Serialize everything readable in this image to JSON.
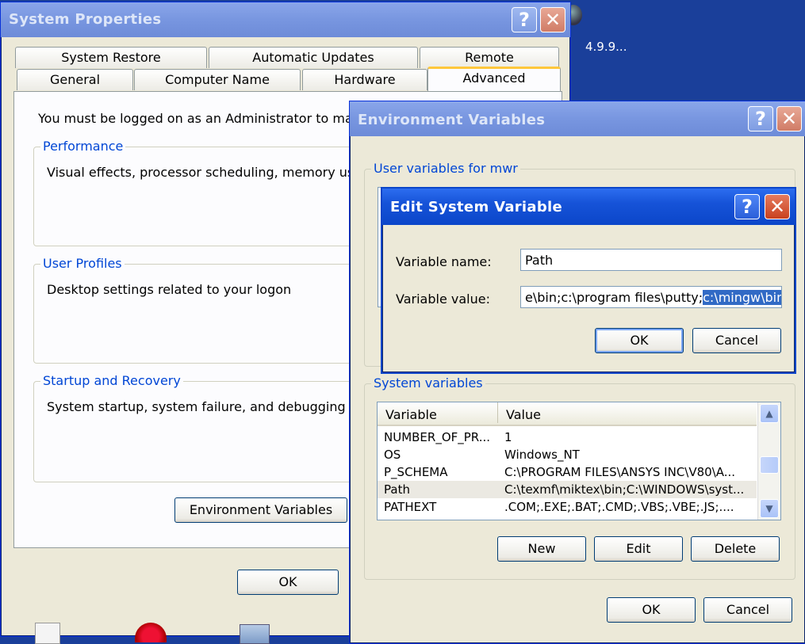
{
  "desktop": {
    "text": "4.9.9..."
  },
  "system_properties": {
    "title": "System Properties",
    "tabs_row1": [
      "System Restore",
      "Automatic Updates",
      "Remote"
    ],
    "tabs_row2": [
      "General",
      "Computer Name",
      "Hardware",
      "Advanced"
    ],
    "active_tab": "Advanced",
    "admin_notice": "You must be logged on as an Administrator to make",
    "performance": {
      "label": "Performance",
      "text": "Visual effects, processor scheduling, memory usa"
    },
    "user_profiles": {
      "label": "User Profiles",
      "text": "Desktop settings related to your logon"
    },
    "startup_recovery": {
      "label": "Startup and Recovery",
      "text": "System startup, system failure, and debugging info"
    },
    "env_button": "Environment Variables",
    "ok": "OK"
  },
  "environment_variables": {
    "title": "Environment Variables",
    "user_group_label": "User variables for mwr",
    "system_group_label": "System variables",
    "columns": [
      "Variable",
      "Value"
    ],
    "rows": [
      {
        "variable": "NUMBER_OF_PR...",
        "value": "1"
      },
      {
        "variable": "OS",
        "value": "Windows_NT"
      },
      {
        "variable": "P_SCHEMA",
        "value": "C:\\PROGRAM FILES\\ANSYS INC\\V80\\A..."
      },
      {
        "variable": "Path",
        "value": "C:\\texmf\\miktex\\bin;C:\\WINDOWS\\syst..."
      },
      {
        "variable": "PATHEXT",
        "value": ".COM;.EXE;.BAT;.CMD;.VBS;.VBE;.JS;...."
      }
    ],
    "selected_row_index": 3,
    "new": "New",
    "edit": "Edit",
    "delete": "Delete",
    "ok": "OK",
    "cancel": "Cancel"
  },
  "edit_system_variable": {
    "title": "Edit System Variable",
    "name_label": "Variable name:",
    "name_value": "Path",
    "value_label": "Variable value:",
    "value_unselected": "e\\bin;c:\\program files\\putty;",
    "value_selected": "c:\\mingw\\bin",
    "ok": "OK",
    "cancel": "Cancel"
  },
  "window_buttons": {
    "help": "?",
    "close": "✕"
  }
}
